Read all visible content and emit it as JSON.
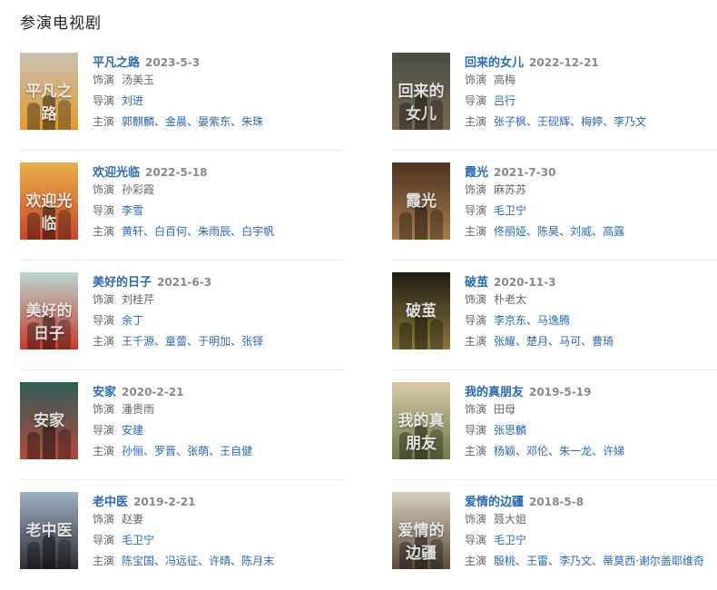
{
  "section": {
    "title": "参演电视剧"
  },
  "labels": {
    "role": "饰演",
    "director": "导演",
    "cast": "主演"
  },
  "shows": [
    {
      "title": "平凡之路",
      "date": "2023-5-3",
      "role": "汤美玉",
      "director": [
        "刘进"
      ],
      "cast": [
        "郭麒麟",
        "金晨",
        "晏紫东",
        "朱珠"
      ],
      "poster_text": "平凡之路",
      "poster_color": "#c8c2b6",
      "poster_accent": "#e39a2a"
    },
    {
      "title": "回来的女儿",
      "date": "2022-12-21",
      "role": "高梅",
      "director": [
        "吕行"
      ],
      "cast": [
        "张子枫",
        "王砚辉",
        "梅婷",
        "李乃文"
      ],
      "poster_text": "回来的女儿",
      "poster_color": "#4a4d45",
      "poster_accent": "#7a6a52"
    },
    {
      "title": "欢迎光临",
      "date": "2022-5-18",
      "role": "孙彩霞",
      "director": [
        "李雪"
      ],
      "cast": [
        "黄轩",
        "白百何",
        "朱雨辰",
        "白宇帆"
      ],
      "poster_text": "欢迎光临",
      "poster_color": "#e9b04a",
      "poster_accent": "#c9452b"
    },
    {
      "title": "霞光",
      "date": "2021-7-30",
      "role": "麻苏苏",
      "director": [
        "毛卫宁"
      ],
      "cast": [
        "佟丽娅",
        "陈昊",
        "刘威",
        "高露"
      ],
      "poster_text": "霞光",
      "poster_color": "#4b3524",
      "poster_accent": "#a97b4a"
    },
    {
      "title": "美好的日子",
      "date": "2021-6-3",
      "role": "刘桂芹",
      "director": [
        "余丁"
      ],
      "cast": [
        "王千源",
        "童蕾",
        "于明加",
        "张铎"
      ],
      "poster_text": "美好的日子",
      "poster_color": "#b9d6d0",
      "poster_accent": "#c83a2a"
    },
    {
      "title": "破茧",
      "date": "2020-11-3",
      "role": "朴老太",
      "director": [
        "李京东",
        "马逸腾"
      ],
      "cast": [
        "张耀",
        "楚月",
        "马可",
        "曹琦"
      ],
      "poster_text": "破茧",
      "poster_color": "#1f1b12",
      "poster_accent": "#8c7a3c"
    },
    {
      "title": "安家",
      "date": "2020-2-21",
      "role": "潘贵雨",
      "director": [
        "安建"
      ],
      "cast": [
        "孙俪",
        "罗晋",
        "张萌",
        "王自健"
      ],
      "poster_text": "安家",
      "poster_color": "#2f5d5a",
      "poster_accent": "#b34a3a"
    },
    {
      "title": "我的真朋友",
      "date": "2019-5-19",
      "role": "田母",
      "director": [
        "张思麟"
      ],
      "cast": [
        "杨颖",
        "邓伦",
        "朱一龙",
        "许娣"
      ],
      "poster_text": "我的真朋友",
      "poster_color": "#d9c9a8",
      "poster_accent": "#6d7a46"
    },
    {
      "title": "老中医",
      "date": "2019-2-21",
      "role": "赵妻",
      "director": [
        "毛卫宁"
      ],
      "cast": [
        "陈宝国",
        "冯远征",
        "许晴",
        "陈月末"
      ],
      "poster_text": "老中医",
      "poster_color": "#9fb1c4",
      "poster_accent": "#2e2e34"
    },
    {
      "title": "爱情的边疆",
      "date": "2018-5-8",
      "role": "聂大姐",
      "director": [
        "毛卫宁"
      ],
      "cast": [
        "殷桃",
        "王雷",
        "李乃文",
        "蒂莫西·谢尔盖耶维奇"
      ],
      "poster_text": "爱情的边疆",
      "poster_color": "#d7cfc0",
      "poster_accent": "#5b4a3c"
    }
  ]
}
